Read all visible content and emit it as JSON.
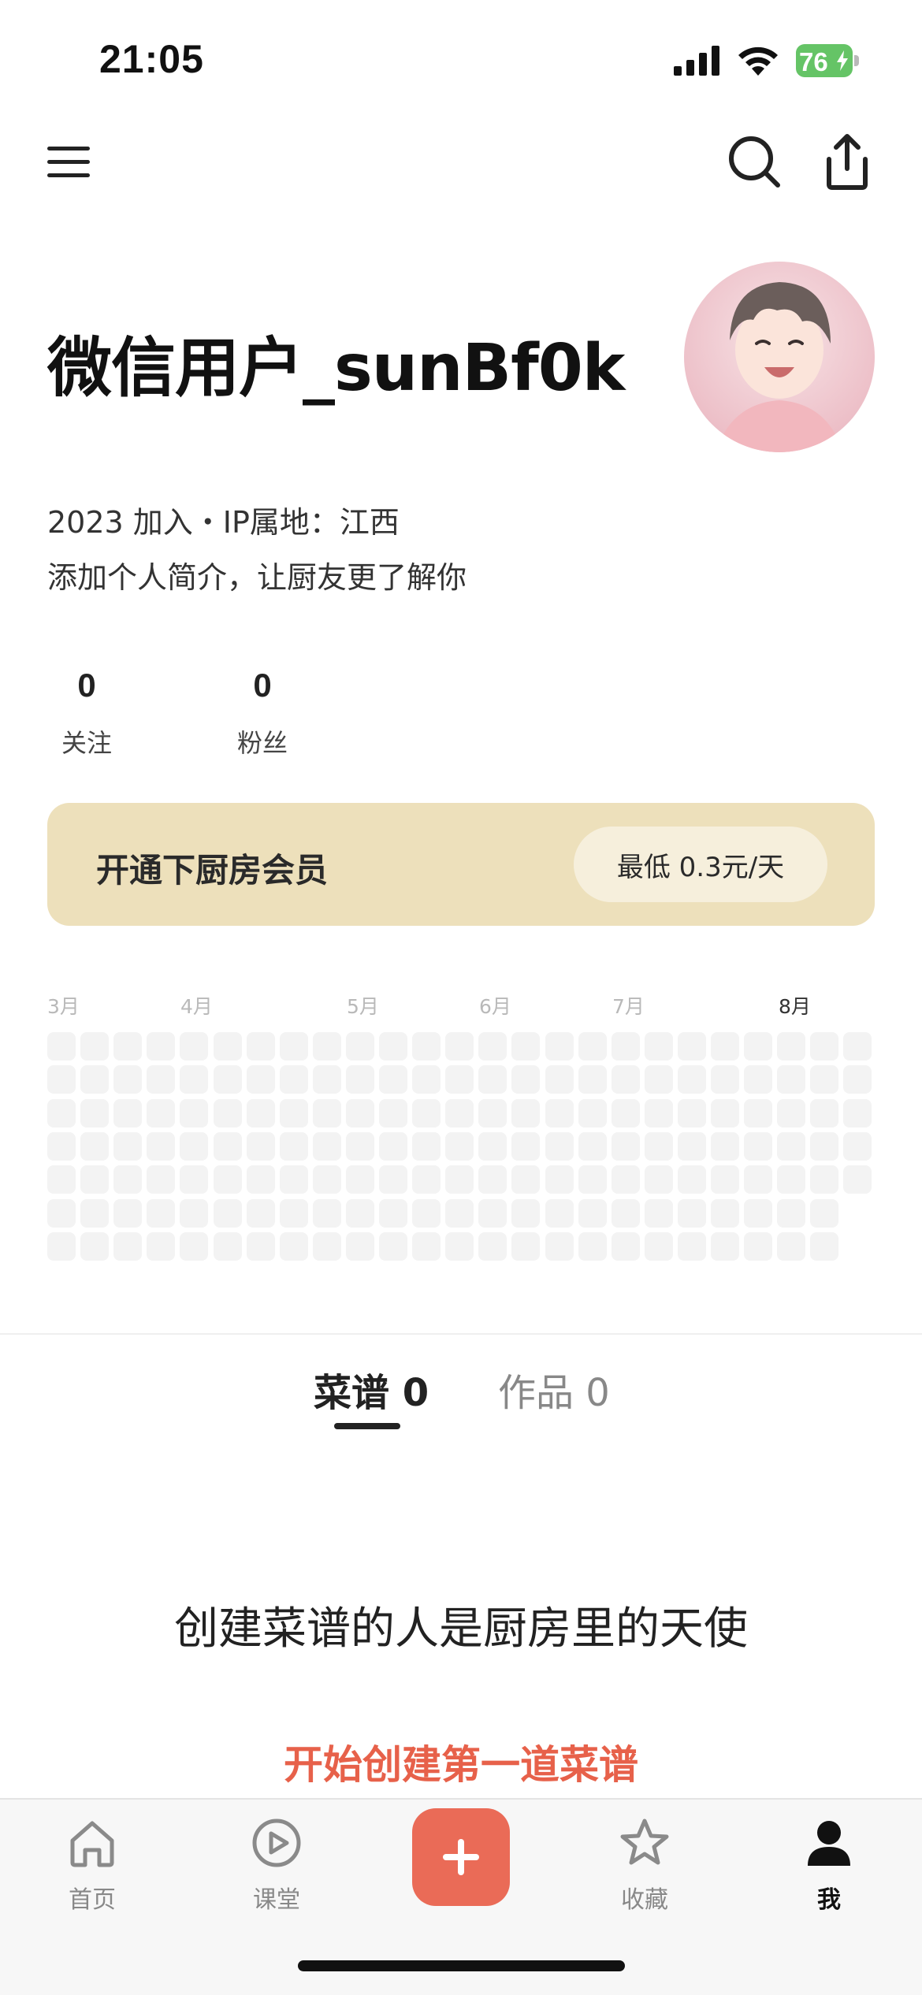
{
  "status_bar": {
    "time": "21:05",
    "battery": "76",
    "icons": [
      "cellular-signal-icon",
      "wifi-icon",
      "battery-charging-icon"
    ]
  },
  "header": {
    "icons": [
      "menu-icon",
      "search-icon",
      "share-icon"
    ]
  },
  "profile": {
    "username": "微信用户_sunBf0k",
    "meta": "2023 加入・IP属地：江西",
    "bio_placeholder": "添加个人简介，让厨友更了解你",
    "stats": [
      {
        "value": "0",
        "label": "关注"
      },
      {
        "value": "0",
        "label": "粉丝"
      }
    ]
  },
  "vip": {
    "title": "开通下厨房会员",
    "price": "最低 0.3元/天"
  },
  "activity": {
    "months": [
      "3月",
      "4月",
      "5月",
      "6月",
      "7月",
      "8月"
    ],
    "current_month": "8月"
  },
  "tabs": [
    {
      "label": "菜谱 0",
      "active": true
    },
    {
      "label": "作品 0",
      "active": false
    }
  ],
  "empty_state": {
    "title": "创建菜谱的人是厨房里的天使",
    "cta": "开始创建第一道菜谱"
  },
  "bottom_nav": [
    {
      "label": "首页",
      "icon": "home-icon",
      "active": false
    },
    {
      "label": "课堂",
      "icon": "play-icon",
      "active": false
    },
    {
      "label": "",
      "icon": "plus-icon",
      "active": false
    },
    {
      "label": "收藏",
      "icon": "star-icon",
      "active": false
    },
    {
      "label": "我",
      "icon": "person-icon",
      "active": true
    }
  ],
  "colors": {
    "accent": "#ea6b57",
    "cta_text": "#e7614a",
    "vip_banner": "#ede0bb",
    "battery": "#65c466"
  }
}
